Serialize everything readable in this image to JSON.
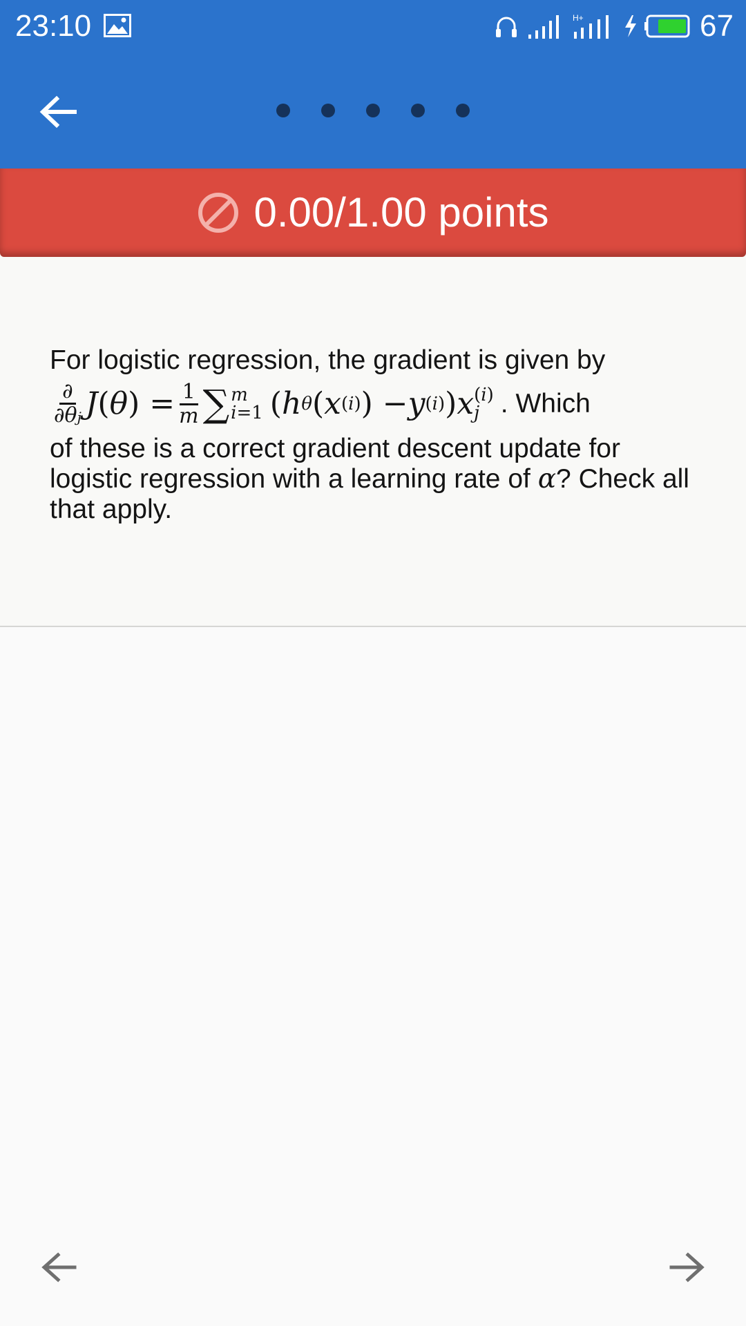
{
  "status_bar": {
    "time": "23:10",
    "battery_level": "67",
    "icons": [
      "gallery-icon",
      "headset-icon",
      "signal-icon",
      "hplus-signal-icon",
      "charging-icon",
      "battery-icon"
    ]
  },
  "app_bar": {
    "back_icon": "arrow-left-icon",
    "pager_dots": 5
  },
  "score": {
    "text": "0.00/1.00 points",
    "icon": "no-entry-icon",
    "color": "#db4a3f"
  },
  "question": {
    "intro": "For logistic regression, the gradient is given by",
    "formula": "∂/∂θj J(θ) = 1/m ∑_{i=1}^{m} (hθ(x^(i)) − y^(i)) xj^(i)",
    "after_formula": ". Which",
    "body_before_alpha": "of these is a correct gradient descent update for logistic regression with a learning rate of",
    "alpha": "α",
    "body_after_alpha": "? Check all that apply."
  },
  "nav": {
    "prev_icon": "arrow-left-icon",
    "next_icon": "arrow-right-icon"
  },
  "colors": {
    "app_bar": "#2b73cc",
    "pager_dot": "#15325a",
    "background": "#f9f9f7"
  }
}
